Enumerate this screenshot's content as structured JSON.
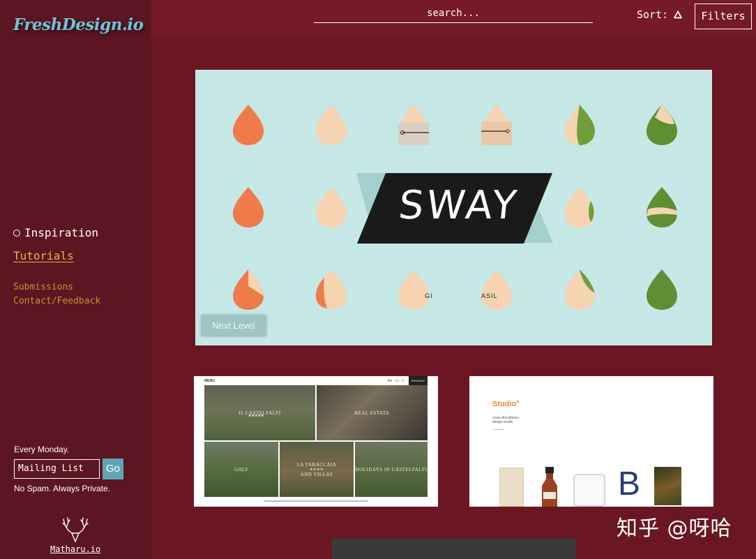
{
  "app": {
    "logo": "FreshDesign.io"
  },
  "header": {
    "search_placeholder": "search...",
    "sort_label": "Sort:",
    "filters_label": "Filters"
  },
  "sidebar": {
    "nav": [
      {
        "label": "Inspiration",
        "active": true
      },
      {
        "label": "Tutorials"
      },
      {
        "label": "Submissions"
      },
      {
        "label": "Contact/Feedback"
      }
    ],
    "mailing": {
      "note": "Every Monday.",
      "placeholder": "Mailing List",
      "button": "Go",
      "privacy": "No Spam. Always Private."
    },
    "footer_link": "Matharu.io"
  },
  "hero": {
    "title": "SWAY",
    "button": "Next Level",
    "drop_labels": [
      "GI",
      "ASIL"
    ]
  },
  "thumbs": {
    "a": {
      "nav_left": "MENU",
      "nav_right": [
        "En",
        "De",
        "It"
      ],
      "booking": "BOOKING",
      "tiles": [
        "IL CASTELFALFI",
        "REAL ESTATE",
        "GOLF",
        "LA TABACCAIA",
        "AND VILLAS",
        "HOLIDAYS IN CASTELFALFI"
      ],
      "stars": "★★★★★",
      "stars4": "★★★★"
    },
    "b": {
      "brand": "Studio°",
      "tagline_1": "cross-disciplinary",
      "tagline_2": "design studio",
      "letter": "B"
    }
  },
  "watermark": "知乎 @呀哈",
  "colors": {
    "background": "#6a1723",
    "sidebar": "#5c1621",
    "topbar": "#761a27",
    "accent_gold": "#e8b251",
    "accent_blue": "#6ec3d8"
  }
}
